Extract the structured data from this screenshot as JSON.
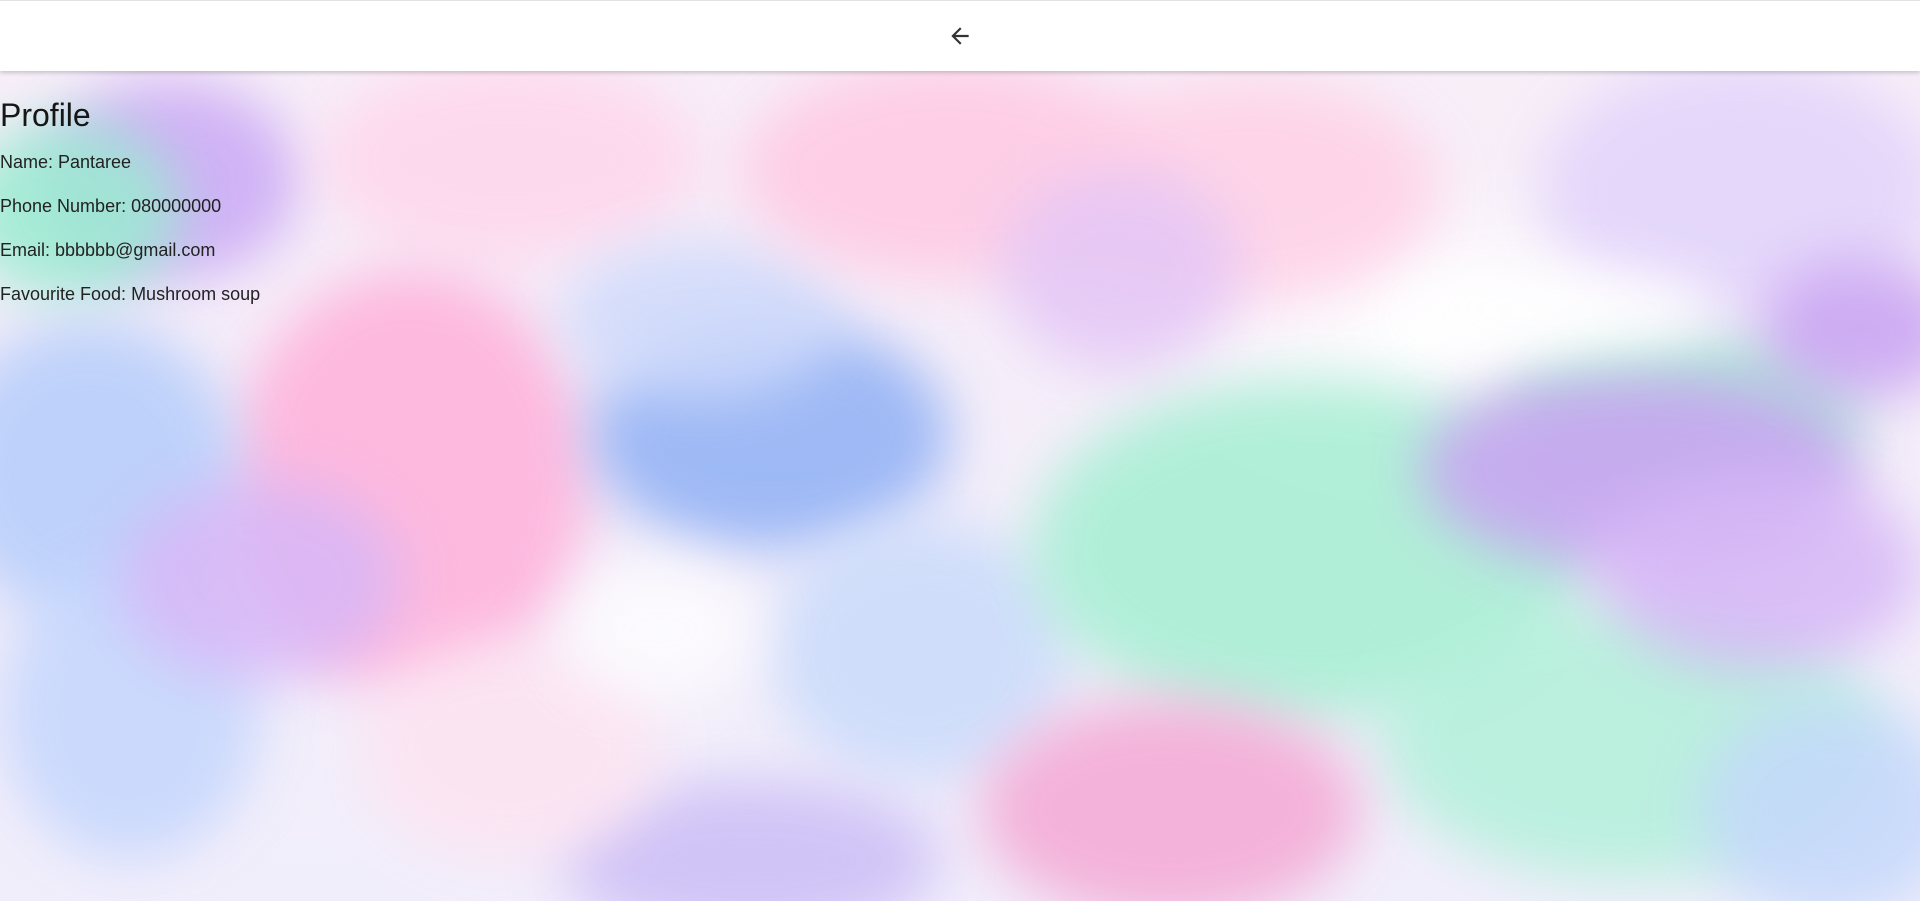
{
  "header": {
    "back_icon": "arrow-left-icon"
  },
  "profile": {
    "title": "Profile",
    "name": "Name: Pantaree",
    "phone": "Phone Number: 080000000",
    "email": "Email: bbbbbb@gmail.com",
    "favourite_food": "Favourite Food: Mushroom soup"
  },
  "colors": {
    "text": "#1b1b1b",
    "topbar": "#ffffff",
    "watercolor_pink": "#ff9fd0",
    "watercolor_purple": "#c6a4f6",
    "watercolor_blue": "#8fb4f4",
    "watercolor_mint": "#8ee9c6"
  }
}
